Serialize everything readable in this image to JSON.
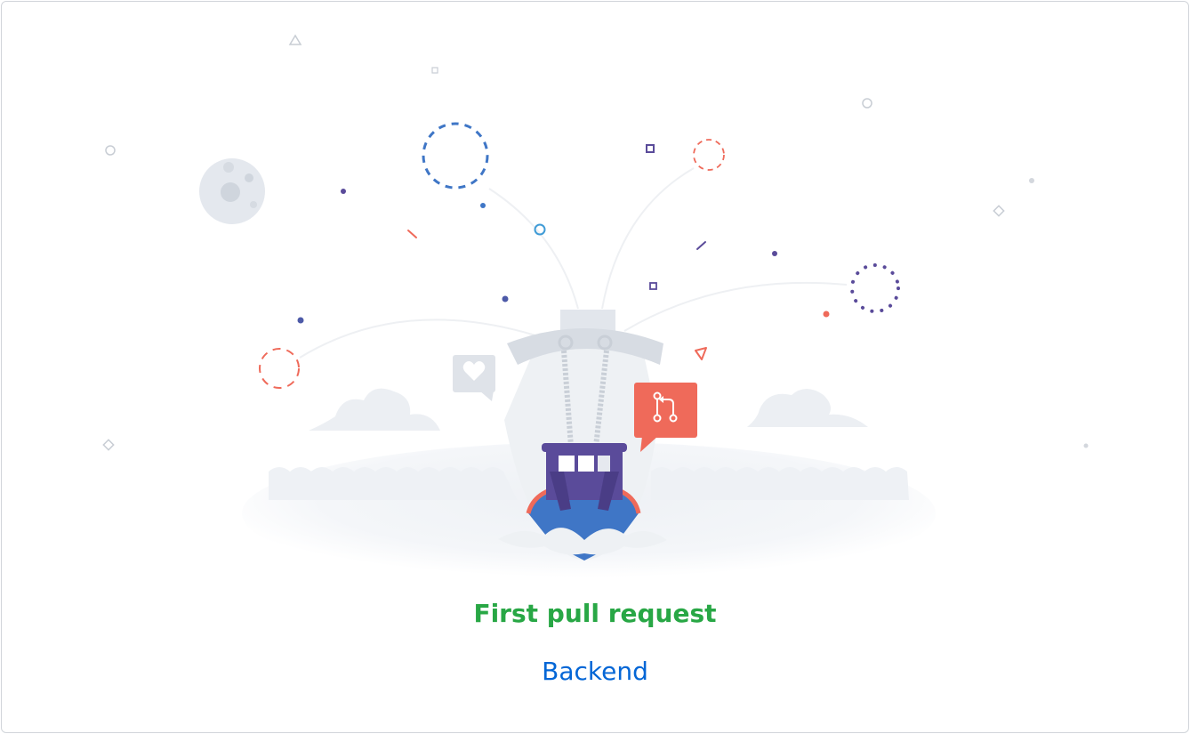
{
  "achievement": {
    "title": "First pull request",
    "repository": "Backend"
  },
  "illustration": {
    "icons": [
      "heart-icon",
      "pull-request-icon"
    ]
  },
  "colors": {
    "title": "#28a745",
    "link": "#0366d6",
    "boat_purple": "#5a4b9a",
    "boat_blue": "#3f76c6",
    "accent_red": "#ef6a5a",
    "sea": "#f3f5f8"
  }
}
